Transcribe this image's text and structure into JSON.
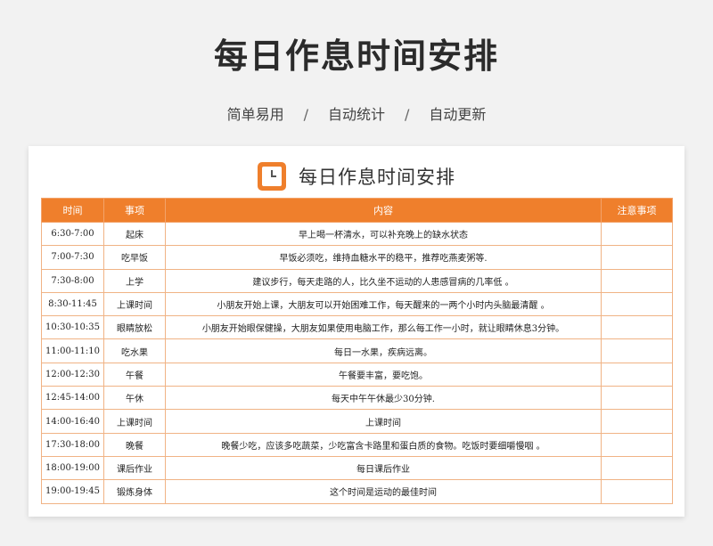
{
  "header": {
    "title": "每日作息时间安排",
    "tags": [
      "简单易用",
      "自动统计",
      "自动更新"
    ],
    "separator": "/"
  },
  "sheet": {
    "title": "每日作息时间安排",
    "icon": "clock-icon",
    "accent_color": "#ef7f2c",
    "columns": [
      "时间",
      "事项",
      "内容",
      "注意事项"
    ],
    "rows": [
      {
        "time": "6:30-7:00",
        "item": "起床",
        "content": "早上喝一杯清水，可以补充晚上的缺水状态",
        "note": ""
      },
      {
        "time": "7:00-7:30",
        "item": "吃早饭",
        "content": "早饭必须吃，维持血糖水平的稳平，推荐吃燕麦粥等.",
        "note": ""
      },
      {
        "time": "7:30-8:00",
        "item": "上学",
        "content": "建议步行，每天走路的人，比久坐不运动的人患感冒病的几率低 。",
        "note": ""
      },
      {
        "time": "8:30-11:45",
        "item": "上课时间",
        "content": "小朋友开始上课，大朋友可以开始困难工作，每天醒来的一两个小时内头脑最清醒 。",
        "note": ""
      },
      {
        "time": "10:30-10:35",
        "item": "眼睛放松",
        "content": "小朋友开始眼保健操，大朋友如果使用电脑工作，那么每工作一小时，就让眼睛休息3分钟。",
        "note": ""
      },
      {
        "time": "11:00-11:10",
        "item": "吃水果",
        "content": "每日一水果，疾病远离。",
        "note": ""
      },
      {
        "time": "12:00-12:30",
        "item": "午餐",
        "content": "午餐要丰富，要吃饱。",
        "note": ""
      },
      {
        "time": "12:45-14:00",
        "item": "午休",
        "content": "每天中午午休最少30分钟.",
        "note": ""
      },
      {
        "time": "14:00-16:40",
        "item": "上课时间",
        "content": "上课时间",
        "note": ""
      },
      {
        "time": "17:30-18:00",
        "item": "晚餐",
        "content": "晚餐少吃，应该多吃蔬菜，少吃富含卡路里和蛋白质的食物。吃饭时要细嚼慢咽 。",
        "note": ""
      },
      {
        "time": "18:00-19:00",
        "item": "课后作业",
        "content": "每日课后作业",
        "note": ""
      },
      {
        "time": "19:00-19:45",
        "item": "锻炼身体",
        "content": "这个时间是运动的最佳时间",
        "note": ""
      }
    ]
  }
}
